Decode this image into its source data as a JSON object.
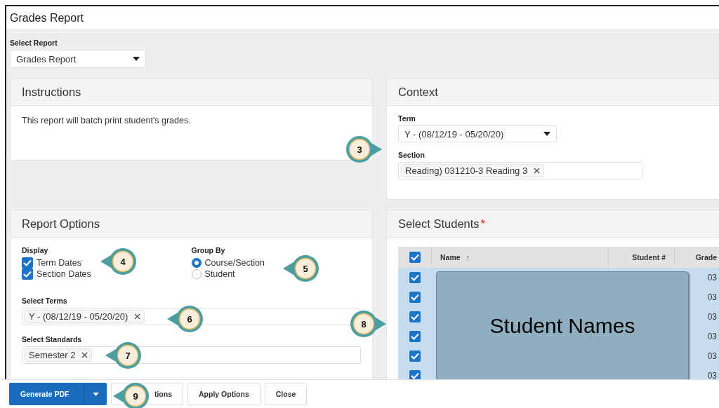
{
  "window": {
    "title": "Grades Report"
  },
  "select_report": {
    "label": "Select Report",
    "value": "Grades Report"
  },
  "instructions": {
    "title": "Instructions",
    "text": "This report will batch print student's grades."
  },
  "context": {
    "title": "Context",
    "term_label": "Term",
    "term_value": "Y - (08/12/19 - 05/20/20)",
    "section_label": "Section",
    "section_tags": [
      "Reading) 031210-3 Reading 3"
    ]
  },
  "report_options": {
    "title": "Report Options",
    "display_label": "Display",
    "display": [
      {
        "label": "Term Dates",
        "checked": true
      },
      {
        "label": "Section Dates",
        "checked": true
      }
    ],
    "group_by_label": "Group By",
    "group_by": [
      {
        "label": "Course/Section",
        "selected": true
      },
      {
        "label": "Student",
        "selected": false
      }
    ],
    "terms_label": "Select Terms",
    "terms_tags": [
      "Y - (08/12/19 - 05/20/20)"
    ],
    "standards_label": "Select Standards",
    "standards_tags": [
      "Semester 2"
    ]
  },
  "select_students": {
    "title": "Select Students",
    "required_mark": "*",
    "all_checked": true,
    "columns": [
      "Name",
      "Student #",
      "Grade"
    ],
    "sort_icon": "↑",
    "rows": [
      {
        "checked": true,
        "grade": "03"
      },
      {
        "checked": true,
        "grade": "03"
      },
      {
        "checked": true,
        "grade": "03"
      },
      {
        "checked": true,
        "grade": "03"
      },
      {
        "checked": true,
        "grade": "03"
      },
      {
        "checked": true,
        "grade": "03"
      }
    ],
    "overlay": "Student Names"
  },
  "footer": {
    "primary": "Generate PDF",
    "buttons": [
      "tions",
      "Apply Options",
      "Close"
    ]
  },
  "callouts": [
    {
      "number": "3"
    },
    {
      "number": "4"
    },
    {
      "number": "5"
    },
    {
      "number": "6"
    },
    {
      "number": "7"
    },
    {
      "number": "8"
    },
    {
      "number": "9"
    }
  ]
}
